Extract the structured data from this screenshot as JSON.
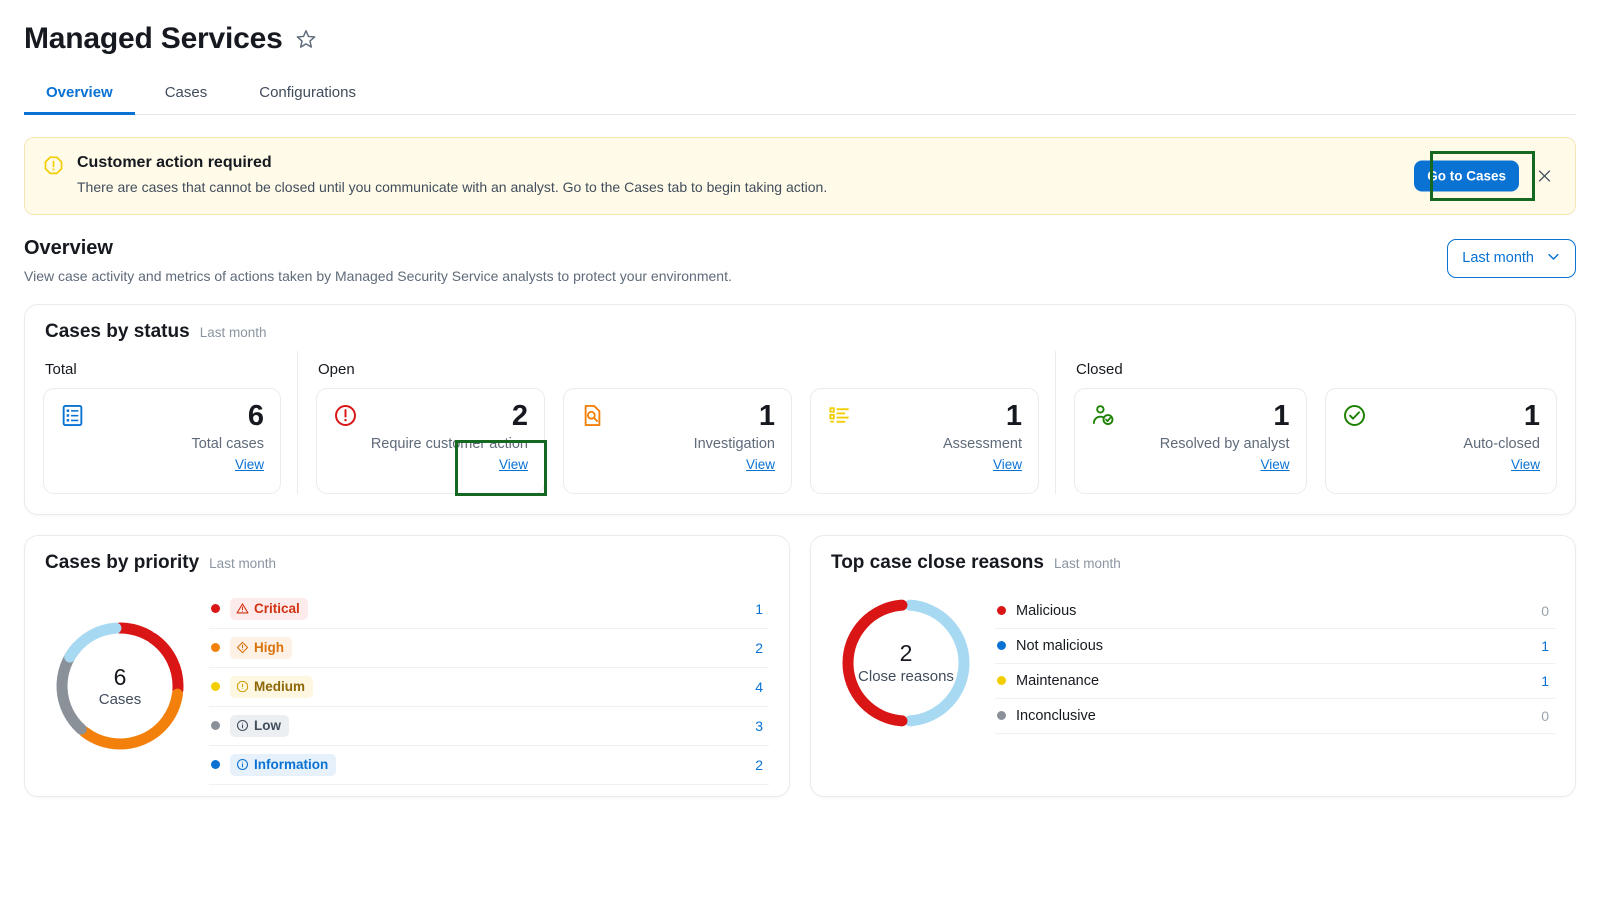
{
  "header": {
    "title": "Managed Services",
    "favorite_icon": "star-icon",
    "tabs": [
      {
        "label": "Overview",
        "active": true
      },
      {
        "label": "Cases",
        "active": false
      },
      {
        "label": "Configurations",
        "active": false
      }
    ]
  },
  "alert": {
    "icon": "warning-hexagon-icon",
    "title": "Customer action required",
    "description": "There are cases that cannot be closed until you communicate with an analyst. Go to the Cases tab to begin taking action.",
    "action_label": "Go to Cases",
    "close_icon": "close-icon",
    "accent_color": "#fffbe8"
  },
  "overview": {
    "title": "Overview",
    "description": "View case activity and metrics of actions taken by Managed Security Service analysts to protect your environment.",
    "date_filter": {
      "value": "Last month",
      "chevron": "chevron-down-icon"
    }
  },
  "cases_by_status": {
    "title": "Cases by status",
    "subtitle": "Last month",
    "groups": [
      {
        "label": "Total",
        "tiles": [
          {
            "icon": "report-list-icon",
            "icon_color": "#0972d3",
            "value": "6",
            "label": "Total cases",
            "view_label": "View"
          }
        ]
      },
      {
        "label": "Open",
        "tiles": [
          {
            "icon": "exclamation-circle-icon",
            "icon_color": "#d91515",
            "value": "2",
            "label": "Require customer action",
            "view_label": "View"
          },
          {
            "icon": "document-search-icon",
            "icon_color": "#f2800a",
            "value": "1",
            "label": "Investigation",
            "view_label": "View"
          },
          {
            "icon": "checklist-icon",
            "icon_color": "#f2cd00",
            "value": "1",
            "label": "Assessment",
            "view_label": "View"
          }
        ]
      },
      {
        "label": "Closed",
        "tiles": [
          {
            "icon": "user-check-icon",
            "icon_color": "#1d8102",
            "value": "1",
            "label": "Resolved by analyst",
            "view_label": "View"
          },
          {
            "icon": "check-circle-icon",
            "icon_color": "#1d8102",
            "value": "1",
            "label": "Auto-closed",
            "view_label": "View"
          }
        ]
      }
    ]
  },
  "annotations": [
    {
      "name": "go-to-cases-highlight",
      "color": "#14681f"
    },
    {
      "name": "require-customer-action-view-highlight",
      "color": "#14681f"
    }
  ],
  "chart_data": [
    {
      "type": "pie",
      "name": "cases_by_priority",
      "title": "Cases by priority",
      "subtitle": "Last month",
      "center_value": "6",
      "center_caption": "Cases",
      "legend_position": "right",
      "categories": [
        "Critical",
        "High",
        "Medium",
        "Low",
        "Information"
      ],
      "values": [
        1,
        2,
        4,
        3,
        2
      ],
      "colors": [
        "#d91515",
        "#f2800a",
        "#f2cd00",
        "#8b9199",
        "#a7d9f2"
      ],
      "slices": [
        {
          "label": "Critical",
          "value": 1,
          "color": "#d91515",
          "badge_class": "b-critical",
          "badge_icon": "warning-triangle-icon",
          "dot_color": "#d91515",
          "arc_deg": 30,
          "start_deg": 0
        },
        {
          "label": "High",
          "value": 2,
          "color": "#d91515",
          "badge_class": "b-high",
          "badge_icon": "warning-diamond-icon",
          "dot_color": "#f2800a",
          "arc_deg": 60,
          "start_deg": 34
        },
        {
          "label": "Medium",
          "value": 4,
          "color": "#f2800a",
          "badge_class": "b-medium",
          "badge_icon": "warning-hexagon-icon",
          "dot_color": "#f2cd00",
          "arc_deg": 120,
          "start_deg": 98
        },
        {
          "label": "Low",
          "value": 3,
          "color": "#8b9199",
          "badge_class": "b-low",
          "badge_icon": "info-circle-icon",
          "dot_color": "#8b9199",
          "arc_deg": 90,
          "start_deg": 222
        },
        {
          "label": "Information",
          "value": 2,
          "color": "#a7d9f2",
          "badge_class": "b-info",
          "badge_icon": "info-circle-icon",
          "dot_color": "#0972d3",
          "arc_deg": 56,
          "start_deg": 300
        }
      ]
    },
    {
      "type": "pie",
      "name": "top_case_close_reasons",
      "title": "Top case close reasons",
      "subtitle": "Last month",
      "center_value": "2",
      "center_caption": "Close reasons",
      "legend_position": "right",
      "categories": [
        "Malicious",
        "Not malicious",
        "Maintenance",
        "Inconclusive"
      ],
      "values": [
        0,
        1,
        1,
        0
      ],
      "colors": [
        "#d91515",
        "#0972d3",
        "#f2cd00",
        "#8b9199"
      ],
      "slices": [
        {
          "label": "Malicious",
          "value": 0,
          "dot_color": "#d91515",
          "muted": true
        },
        {
          "label": "Not malicious",
          "value": 1,
          "dot_color": "#0972d3",
          "muted": false
        },
        {
          "label": "Maintenance",
          "value": 1,
          "dot_color": "#f2cd00",
          "muted": false
        },
        {
          "label": "Inconclusive",
          "value": 0,
          "dot_color": "#8b9199",
          "muted": true
        }
      ],
      "donut_arcs": [
        {
          "color": "#a7d9f2",
          "start_deg": 4,
          "arc_deg": 172
        },
        {
          "color": "#d91515",
          "start_deg": 184,
          "arc_deg": 172
        }
      ]
    }
  ]
}
